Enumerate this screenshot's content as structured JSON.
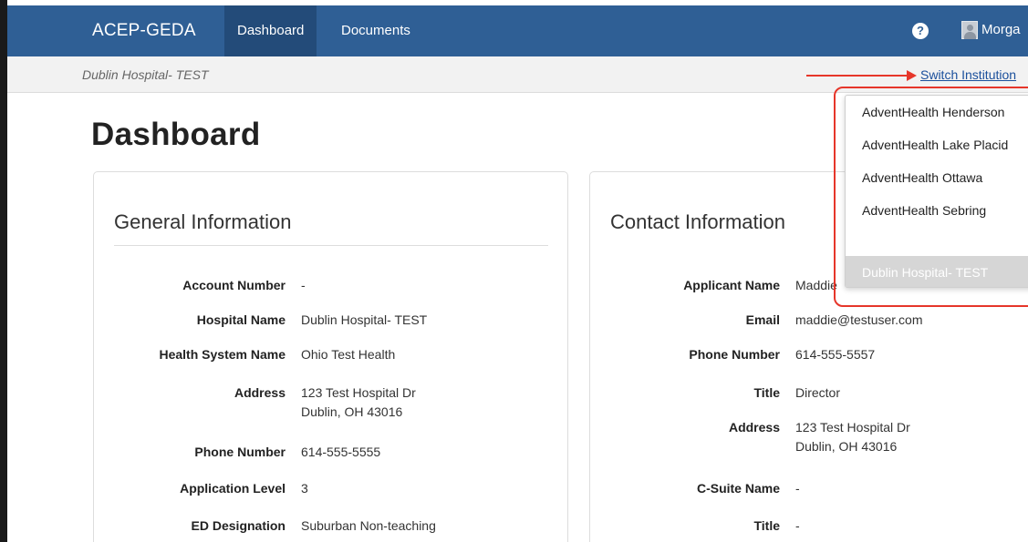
{
  "nav": {
    "brand": "ACEP-GEDA",
    "links": [
      "Dashboard",
      "Documents"
    ],
    "help_icon_glyph": "?",
    "user_name": "Morga"
  },
  "subbar": {
    "institution": "Dublin Hospital- TEST",
    "switch_label": "Switch Institution"
  },
  "page_title": "Dashboard",
  "general": {
    "title": "General Information",
    "rows": [
      {
        "label": "Account Number",
        "value": "-"
      },
      {
        "label": "Hospital Name",
        "value": "Dublin Hospital- TEST"
      },
      {
        "label": "Health System Name",
        "value": "Ohio Test Health"
      },
      {
        "label": "Address",
        "value": "123 Test Hospital Dr\nDublin, OH 43016"
      },
      {
        "label": "Phone Number",
        "value": "614-555-5555"
      },
      {
        "label": "Application Level",
        "value": "3"
      },
      {
        "label": "ED Designation",
        "value": "Suburban Non-teaching"
      }
    ]
  },
  "contact": {
    "title": "Contact Information",
    "rows": [
      {
        "label": "Applicant Name",
        "value": "Maddie"
      },
      {
        "label": "Email",
        "value": "maddie@testuser.com"
      },
      {
        "label": "Phone Number",
        "value": "614-555-5557"
      },
      {
        "label": "Title",
        "value": "Director"
      },
      {
        "label": "Address",
        "value": "123 Test Hospital Dr\nDublin, OH 43016"
      },
      {
        "label": "C-Suite Name",
        "value": "-"
      },
      {
        "label": "Title",
        "value": "-"
      }
    ]
  },
  "dropdown": {
    "items": [
      "AdventHealth Henderson",
      "AdventHealth Lake Placid",
      "AdventHealth Ottawa",
      "AdventHealth Sebring",
      "Dublin Hospital- TEST"
    ],
    "selected_index": 4
  },
  "colors": {
    "nav_bg": "#2f5f95",
    "annotation_red": "#e6362a",
    "link_blue": "#1a4f9c"
  }
}
